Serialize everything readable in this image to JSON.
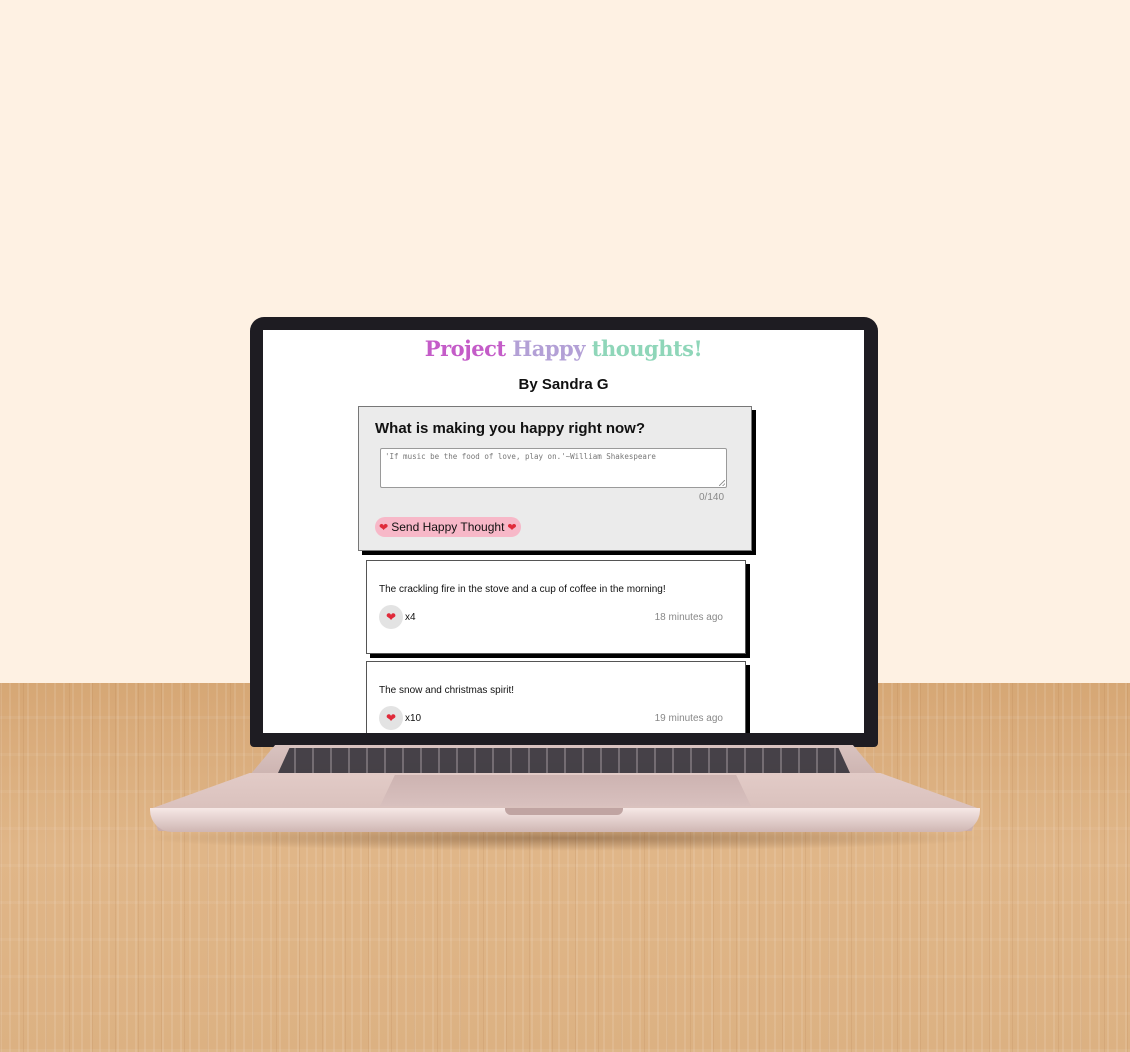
{
  "app": {
    "title_parts": [
      "Project",
      "Happy",
      "thoughts!"
    ],
    "byline": "By Sandra G"
  },
  "form": {
    "question": "What is making you happy right now?",
    "placeholder": "'If music be the food of love, play on.'~William Shakespeare",
    "counter": "0/140",
    "send_label": "Send Happy Thought",
    "send_icon": "heart-icon"
  },
  "thoughts": [
    {
      "message": "The crackling fire in the stove and a cup of coffee in the morning!",
      "likes": "x4",
      "time": "18 minutes ago"
    },
    {
      "message": "The snow and christmas spirit!",
      "likes": "x10",
      "time": "19 minutes ago"
    }
  ],
  "colors": {
    "title_1": "#c45cc8",
    "title_2": "#b3a0d6",
    "title_3": "#8fd6b9",
    "send_button": "#f7b8c8",
    "heart": "#e02a3a",
    "wall": "#fef1e3"
  }
}
